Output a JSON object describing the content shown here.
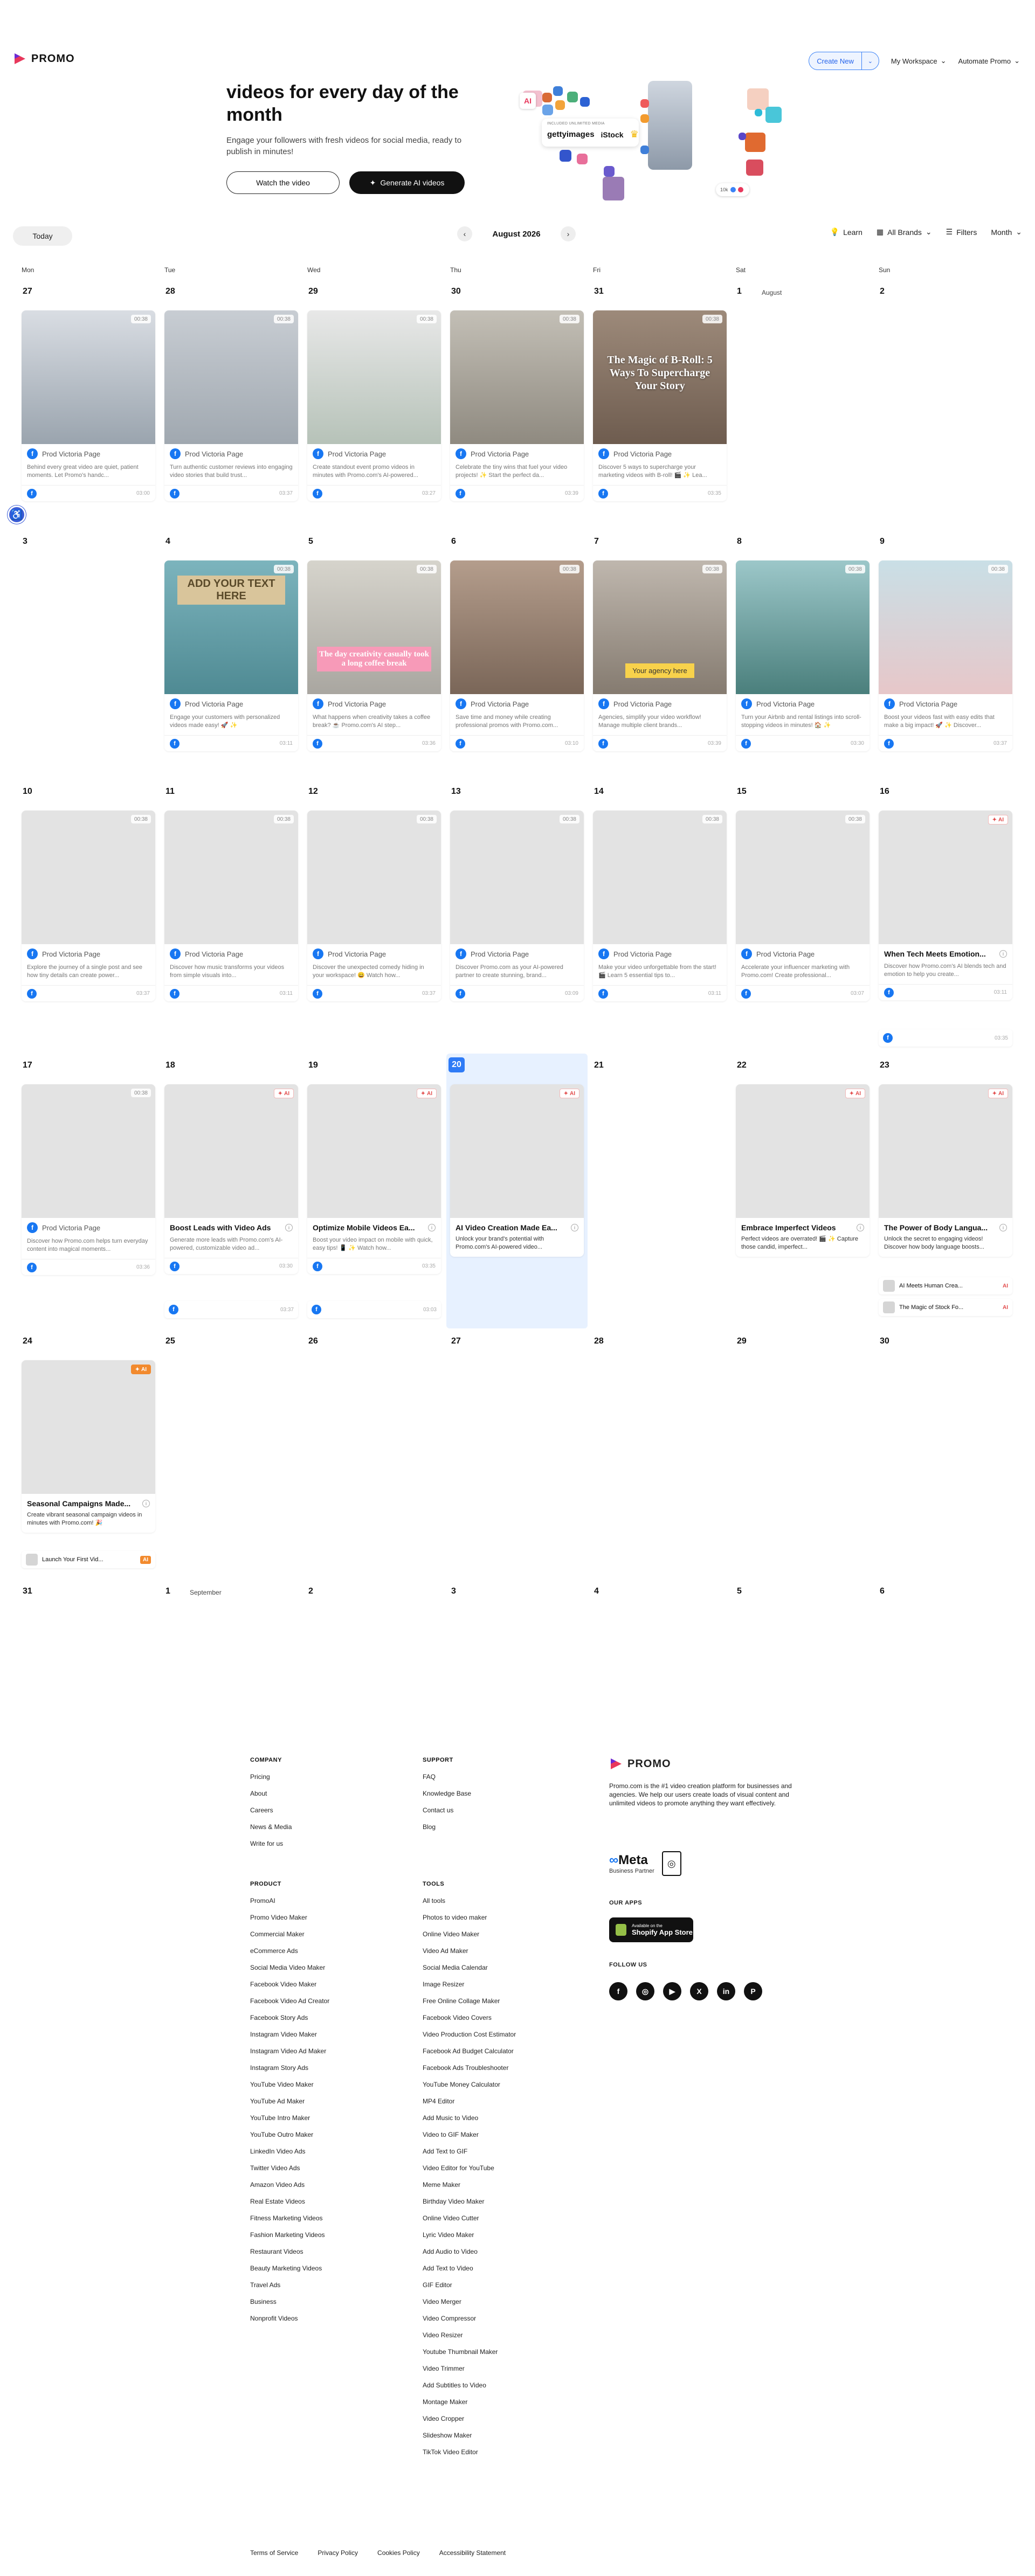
{
  "header": {
    "brand": "PROMO",
    "create_new": "Create New",
    "my_workspace": "My Workspace",
    "automate_promo": "Automate Promo"
  },
  "hero": {
    "title": "videos for every day of the month",
    "subtitle": "Engage your followers with fresh videos for social media, ready to publish in minutes!",
    "watch_btn": "Watch the video",
    "generate_btn": "Generate AI videos",
    "badge_included": "INCLUDED UNLIMITED MEDIA",
    "getty": "gettyimages",
    "istock": "iStock",
    "likes": "10k"
  },
  "toolbar": {
    "today": "Today",
    "month_label": "August 2026",
    "learn": "Learn",
    "brands": "All Brands",
    "filters": "Filters",
    "view": "Month"
  },
  "weekdays": [
    "Mon",
    "Tue",
    "Wed",
    "Thu",
    "Fri",
    "Sat",
    "Sun"
  ],
  "weeks": [
    [
      "27",
      "28",
      "29",
      "30",
      "31",
      "1",
      "2"
    ],
    [
      "3",
      "4",
      "5",
      "6",
      "7",
      "8",
      "9"
    ],
    [
      "10",
      "11",
      "12",
      "13",
      "14",
      "15",
      "16"
    ],
    [
      "17",
      "18",
      "19",
      "20",
      "21",
      "22",
      "23"
    ],
    [
      "24",
      "25",
      "26",
      "27",
      "28",
      "29",
      "30"
    ],
    [
      "31",
      "1",
      "2",
      "3",
      "4",
      "5",
      "6"
    ]
  ],
  "month_markers": {
    "august": "August",
    "september": "September"
  },
  "page_name": "Prod Victoria Page",
  "cards": {
    "w1_mon": {
      "dur": "00:38",
      "desc": "Behind every great video are quiet, patient moments. Let Promo's handc...",
      "headline": "",
      "time": "03:00"
    },
    "w1_tue": {
      "dur": "00:38",
      "desc": "Turn authentic customer reviews into engaging video stories that build trust...",
      "time": "03:37"
    },
    "w1_wed": {
      "dur": "00:38",
      "desc": "Create standout event promo videos in minutes with Promo.com's AI-powered...",
      "time": "03:27"
    },
    "w1_thu": {
      "dur": "00:38",
      "desc": "Celebrate the tiny wins that fuel your video projects! ✨ Start the perfect da...",
      "time": "03:39"
    },
    "w1_fri": {
      "dur": "00:38",
      "desc": "Discover 5 ways to supercharge your marketing videos with B-roll! 🎬 ✨ Lea...",
      "headline": "The Magic of B-Roll: 5 Ways To Supercharge Your Story",
      "time": "03:35"
    },
    "w2_tue": {
      "dur": "00:38",
      "desc": "Engage your customers with personalized videos made easy! 🚀 ✨",
      "sticker": "ADD YOUR TEXT HERE",
      "time": "03:11"
    },
    "w2_wed": {
      "dur": "00:38",
      "desc": "What happens when creativity takes a coffee break? ☕ Promo.com's AI step...",
      "pink": "The day creativity casually took a long coffee break",
      "time": "03:36"
    },
    "w2_thu": {
      "dur": "00:38",
      "desc": "Save time and money while creating professional promos with Promo.com...",
      "time": "03:10"
    },
    "w2_fri": {
      "dur": "00:38",
      "desc": "Agencies, simplify your video workflow! Manage multiple client brands...",
      "yellow": "Your agency here",
      "time": "03:39"
    },
    "w2_sat": {
      "dur": "00:38",
      "desc": "Turn your Airbnb and rental listings into scroll-stopping videos in minutes! 🏠 ✨",
      "time": "03:30"
    },
    "w2_sun": {
      "dur": "00:38",
      "desc": "Boost your videos fast with easy edits that make a big impact! 🚀 ✨ Discover...",
      "time": "03:37"
    },
    "w3_mon": {
      "dur": "00:38",
      "desc": "Explore the journey of a single post and see how tiny details can create power...",
      "time": "03:37"
    },
    "w3_tue": {
      "dur": "00:38",
      "desc": "Discover how music transforms your videos from simple visuals into...",
      "time": "03:11"
    },
    "w3_wed": {
      "dur": "00:38",
      "desc": "Discover the unexpected comedy hiding in your workspace! 😄 Watch how...",
      "time": "03:37"
    },
    "w3_thu": {
      "dur": "00:38",
      "desc": "Discover Promo.com as your AI-powered partner to create stunning, brand...",
      "time": "03:09"
    },
    "w3_fri": {
      "dur": "00:38",
      "desc": "Make your video unforgettable from the start! 🎬 Learn 5 essential tips to...",
      "time": "03:11"
    },
    "w3_sat": {
      "dur": "00:38",
      "desc": "Accelerate your influencer marketing with Promo.com! Create professional...",
      "time": "03:07"
    },
    "w3_sun": {
      "title": "When Tech Meets Emotion...",
      "desc": "Discover how Promo.com's AI blends tech and emotion to help you create...",
      "time1": "03:11",
      "time2": "03:35"
    },
    "w4_mon": {
      "dur": "00:38",
      "desc": "Discover how Promo.com helps turn everyday content into magical moments...",
      "time": "03:36"
    },
    "w4_tue": {
      "title": "Boost Leads with Video Ads",
      "desc": "Generate more leads with Promo.com's AI-powered, customizable video ad...",
      "time1": "03:30",
      "time2": "03:37"
    },
    "w4_wed": {
      "title": "Optimize Mobile Videos Ea...",
      "desc": "Boost your video impact on mobile with quick, easy tips! 📱 ✨ Watch how...",
      "time1": "03:35",
      "time2": "03:03"
    },
    "w4_thu": {
      "title": "AI Video Creation Made Ea...",
      "desc": "Unlock your brand's potential with Promo.com's AI-powered video..."
    },
    "w4_sat": {
      "title": "Embrace Imperfect Videos",
      "desc": "Perfect videos are overrated! 🎬 ✨ Capture those candid, imperfect..."
    },
    "w4_sun": {
      "title": "The Power of Body Langua...",
      "desc": "Unlock the secret to engaging videos! Discover how body language boosts...",
      "sub1": "AI Meets Human Crea...",
      "sub2": "The Magic of Stock Fo..."
    },
    "w5_mon": {
      "title": "Seasonal Campaigns Made...",
      "desc": "Create vibrant seasonal campaign videos in minutes with Promo.com! 🎉",
      "sub1": "Launch Your First Vid..."
    }
  },
  "ai_label": "AI",
  "footer": {
    "company_h": "COMPANY",
    "company": [
      "Pricing",
      "About",
      "Careers",
      "News & Media",
      "Write for us"
    ],
    "support_h": "SUPPORT",
    "support": [
      "FAQ",
      "Knowledge Base",
      "Contact us",
      "Blog"
    ],
    "product_h": "PRODUCT",
    "product": [
      "PromoAI",
      "Promo Video Maker",
      "Commercial Maker",
      "eCommerce Ads",
      "Social Media Video Maker",
      "Facebook Video Maker",
      "Facebook Video Ad Creator",
      "Facebook Story Ads",
      "Instagram Video Maker",
      "Instagram Video Ad Maker",
      "Instagram Story Ads",
      "YouTube Video Maker",
      "YouTube Ad Maker",
      "YouTube Intro Maker",
      "YouTube Outro Maker",
      "LinkedIn Video Ads",
      "Twitter Video Ads",
      "Amazon Video Ads",
      "Real Estate Videos",
      "Fitness Marketing Videos",
      "Fashion Marketing Videos",
      "Restaurant Videos",
      "Beauty Marketing Videos",
      "Travel Ads",
      "Business",
      "Nonprofit Videos"
    ],
    "tools_h": "TOOLS",
    "tools": [
      "All tools",
      "Photos to video maker",
      "Online Video Maker",
      "Video Ad Maker",
      "Social Media Calendar",
      "Image Resizer",
      "Free Online Collage Maker",
      "Facebook Video Covers",
      "Video Production Cost Estimator",
      "Facebook Ad Budget Calculator",
      "Facebook Ads Troubleshooter",
      "YouTube Money Calculator",
      "MP4 Editor",
      "Add Music to Video",
      "Video to GIF Maker",
      "Add Text to GIF",
      "Video Editor for YouTube",
      "Meme Maker",
      "Birthday Video Maker",
      "Online Video Cutter",
      "Lyric Video Maker",
      "Add Audio to Video",
      "Add Text to Video",
      "GIF Editor",
      "Video Merger",
      "Video Compressor",
      "Video Resizer",
      "Youtube Thumbnail Maker",
      "Video Trimmer",
      "Add Subtitles to Video",
      "Montage Maker",
      "Video Cropper",
      "Slideshow Maker",
      "TikTok Video Editor"
    ],
    "brand": "PROMO",
    "brand_desc": "Promo.com is the #1 video creation platform for businesses and agencies. We help our users create loads of visual content and unlimited videos to promote anything they want effectively.",
    "meta": "Meta",
    "meta_sub": "Business Partner",
    "apps_h": "OUR APPS",
    "app_line1": "Available on the",
    "app_line2": "Shopify App Store",
    "follow_h": "FOLLOW US",
    "legal": [
      "Terms of Service",
      "Privacy Policy",
      "Cookies Policy",
      "Accessibility Statement"
    ]
  }
}
